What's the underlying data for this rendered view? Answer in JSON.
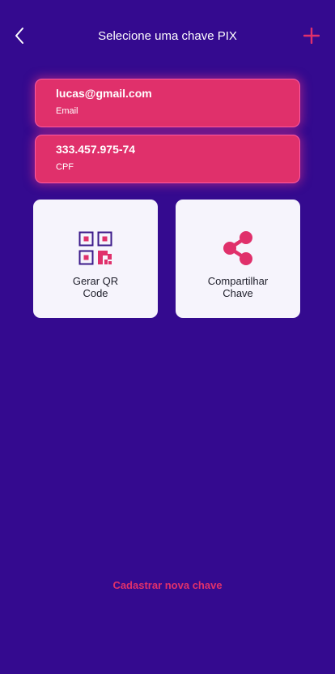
{
  "header": {
    "title": "Selecione uma chave PIX",
    "back_icon": "chevron-left-icon",
    "add_icon": "plus-icon"
  },
  "keys": [
    {
      "value": "lucas@gmail.com",
      "type": "Email"
    },
    {
      "value": "333.457.975-74",
      "type": "CPF"
    }
  ],
  "actions": [
    {
      "label_line1": "Gerar QR",
      "label_line2": "Code",
      "icon": "qr-code-icon"
    },
    {
      "label_line1": "Compartilhar",
      "label_line2": "Chave",
      "icon": "share-icon"
    }
  ],
  "footer": {
    "register_label": "Cadastrar nova chave"
  },
  "colors": {
    "background": "#340a8f",
    "accent": "#e0306b",
    "tile_background": "#f6f4fc",
    "qr_icon": "#3c1a8a"
  }
}
